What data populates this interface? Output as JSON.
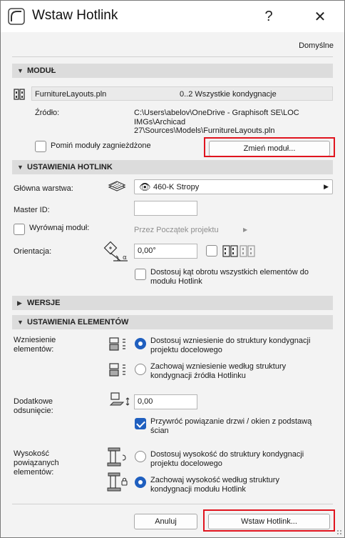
{
  "window": {
    "title": "Wstaw Hotlink",
    "help_glyph": "?",
    "close_glyph": "✕",
    "icon": "archicad-arc-icon"
  },
  "defaults_link": "Domyślne",
  "module_section": {
    "title": "MODUŁ",
    "file_name": "FurnitureLayouts.pln",
    "stories": "0..2 Wszystkie kondygnacje",
    "source_label": "Źródło:",
    "source_path_lines": [
      "C:\\Users\\abelov\\OneDrive - Graphisoft SE\\LOC",
      "IMGs\\Archicad",
      "27\\Sources\\Models\\FurnitureLayouts.pln"
    ],
    "skip_nested_label": "Pomiń moduły zagnieżdżone",
    "skip_nested_checked": false,
    "change_module_button": "Zmień moduł..."
  },
  "hotlink_settings": {
    "title": "USTAWIENIA HOTLINK",
    "main_layer_label": "Główna warstwa:",
    "main_layer_value": "460-K Stropy",
    "master_id_label": "Master ID:",
    "master_id_value": "",
    "align_module_label": "Wyrównaj moduł:",
    "align_module_checked": false,
    "align_module_option": "Przez Początek projektu",
    "orientation_label": "Orientacja:",
    "orientation_value": "0,00°",
    "adjust_rotation_lines": [
      "Dostosuj kąt obrotu wszystkich elementów do",
      "modułu Hotlink"
    ],
    "adjust_rotation_checked": false
  },
  "versions_section": {
    "title": "WERSJE"
  },
  "element_settings": {
    "title": "USTAWIENIA ELEMENTÓW",
    "elevation_label_lines": [
      "Wzniesienie",
      "elementów:"
    ],
    "elevation_options": [
      {
        "lines": [
          "Dostosuj wzniesienie do struktury kondygnacji",
          "projektu docelowego"
        ],
        "selected": true
      },
      {
        "lines": [
          "Zachowaj wzniesienie według struktury",
          "kondygnacji źródła Hotlinku"
        ],
        "selected": false
      }
    ],
    "offset_label_lines": [
      "Dodatkowe",
      "odsunięcie:"
    ],
    "offset_value": "0,00",
    "restore_link_lines": [
      "Przywróć powiązanie drzwi / okien z podstawą",
      "ścian"
    ],
    "restore_link_checked": true,
    "height_label_lines": [
      "Wysokość",
      "powiązanych",
      "elementów:"
    ],
    "height_options": [
      {
        "lines": [
          "Dostosuj wysokość do struktury kondygnacji",
          "projektu docelowego"
        ],
        "selected": false
      },
      {
        "lines": [
          "Zachowaj wysokość według struktury",
          "kondygnacji modułu Hotlink"
        ],
        "selected": true
      }
    ]
  },
  "footer": {
    "cancel_button": "Anuluj",
    "insert_button": "Wstaw Hotlink..."
  },
  "colors": {
    "accent": "#1f5fbf",
    "highlight": "#e0141e",
    "section_bg": "#dcdcdc",
    "content_bg": "#f3f3f3"
  }
}
